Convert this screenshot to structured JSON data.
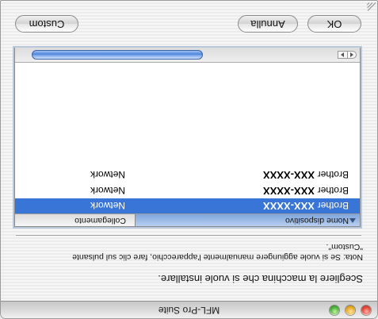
{
  "window": {
    "title": "MFL-Pro Suite"
  },
  "instruction": "Scegliere la macchina che si vuole installare.",
  "note": {
    "line1": "Nota: Se si vuole aggiungere manualmente l'apparecchio, fare clic sul pulsante",
    "line2": "\"Custom\"."
  },
  "table": {
    "columns": {
      "name": "Nome dispositivo",
      "connection": "Collegamento"
    },
    "rows": [
      {
        "brand": "Brother",
        "model": "XXX-XXXX",
        "connection": "Network",
        "selected": true
      },
      {
        "brand": "Brother",
        "model": "XXX-XXXX",
        "connection": "Network",
        "selected": false
      },
      {
        "brand": "Brother",
        "model": "XXX-XXXX",
        "connection": "Network",
        "selected": false
      }
    ]
  },
  "buttons": {
    "ok": "OK",
    "cancel": "Annulla",
    "custom": "Custom"
  },
  "colors": {
    "selection": "#3875d7",
    "close": "#e0473a",
    "minimize": "#e6a823",
    "zoom": "#49b23a"
  },
  "icons": {
    "close": "close-icon",
    "minimize": "minimize-icon",
    "zoom": "zoom-icon",
    "sort": "sort-ascending-icon"
  }
}
